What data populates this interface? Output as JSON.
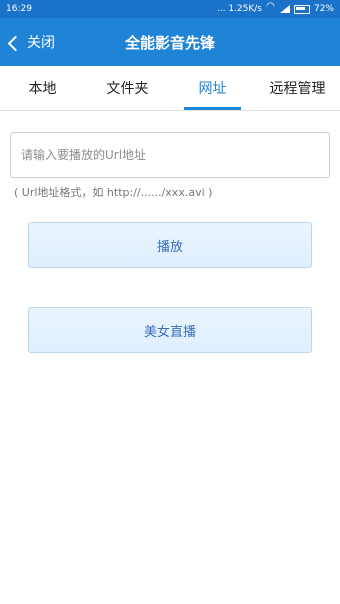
{
  "status": {
    "time": "16:29",
    "network": "... 1.25K/s",
    "battery": "72%"
  },
  "titlebar": {
    "back_label": "关闭",
    "title": "全能影音先锋"
  },
  "tabs": [
    {
      "label": "本地"
    },
    {
      "label": "文件夹"
    },
    {
      "label": "网址"
    },
    {
      "label": "远程管理"
    }
  ],
  "url": {
    "placeholder": "请输入要播放的Url地址",
    "hint": "( Url地址格式，如 http://....../xxx.avi )"
  },
  "buttons": {
    "play": "播放",
    "live": "美女直播"
  },
  "colors": {
    "status_bar": "#1a73c8",
    "title_bar": "#1f83d6",
    "active_tab": "#1f83d6",
    "button_text": "#3b6dbd"
  }
}
